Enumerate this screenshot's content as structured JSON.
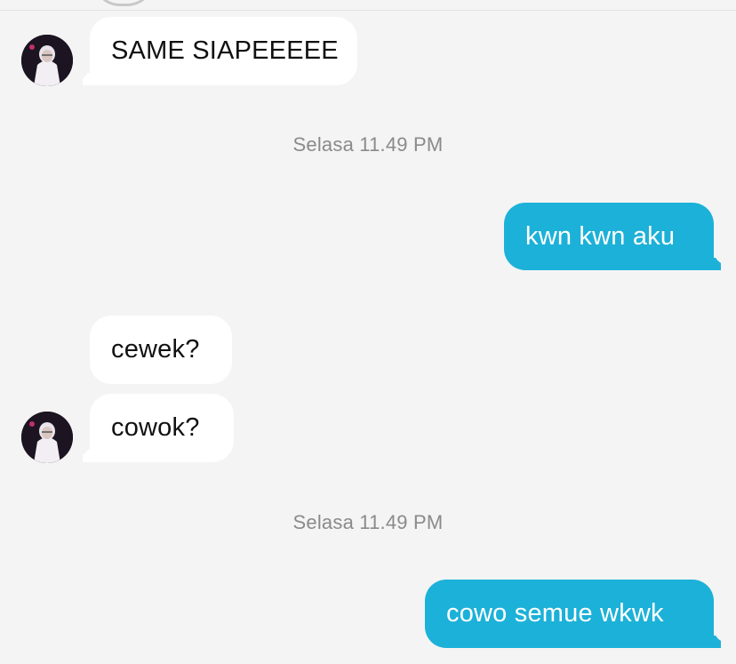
{
  "conversation": {
    "messages": [
      {
        "direction": "incoming",
        "text": "SAME SIAPEEEEE"
      },
      {
        "type": "timestamp",
        "text": "Selasa 11.49 PM"
      },
      {
        "direction": "outgoing",
        "text": "kwn kwn aku"
      },
      {
        "direction": "incoming",
        "text": "cewek?"
      },
      {
        "direction": "incoming",
        "text": "cowok?"
      },
      {
        "type": "timestamp",
        "text": "Selasa 11.49 PM"
      },
      {
        "direction": "outgoing",
        "text": "cowo semue wkwk"
      }
    ]
  },
  "colors": {
    "background": "#f4f4f4",
    "incoming_bubble": "#ffffff",
    "outgoing_bubble": "#1cb1d8",
    "timestamp_text": "#8a8a8a"
  },
  "icons": {
    "avatar": "contact-avatar"
  }
}
